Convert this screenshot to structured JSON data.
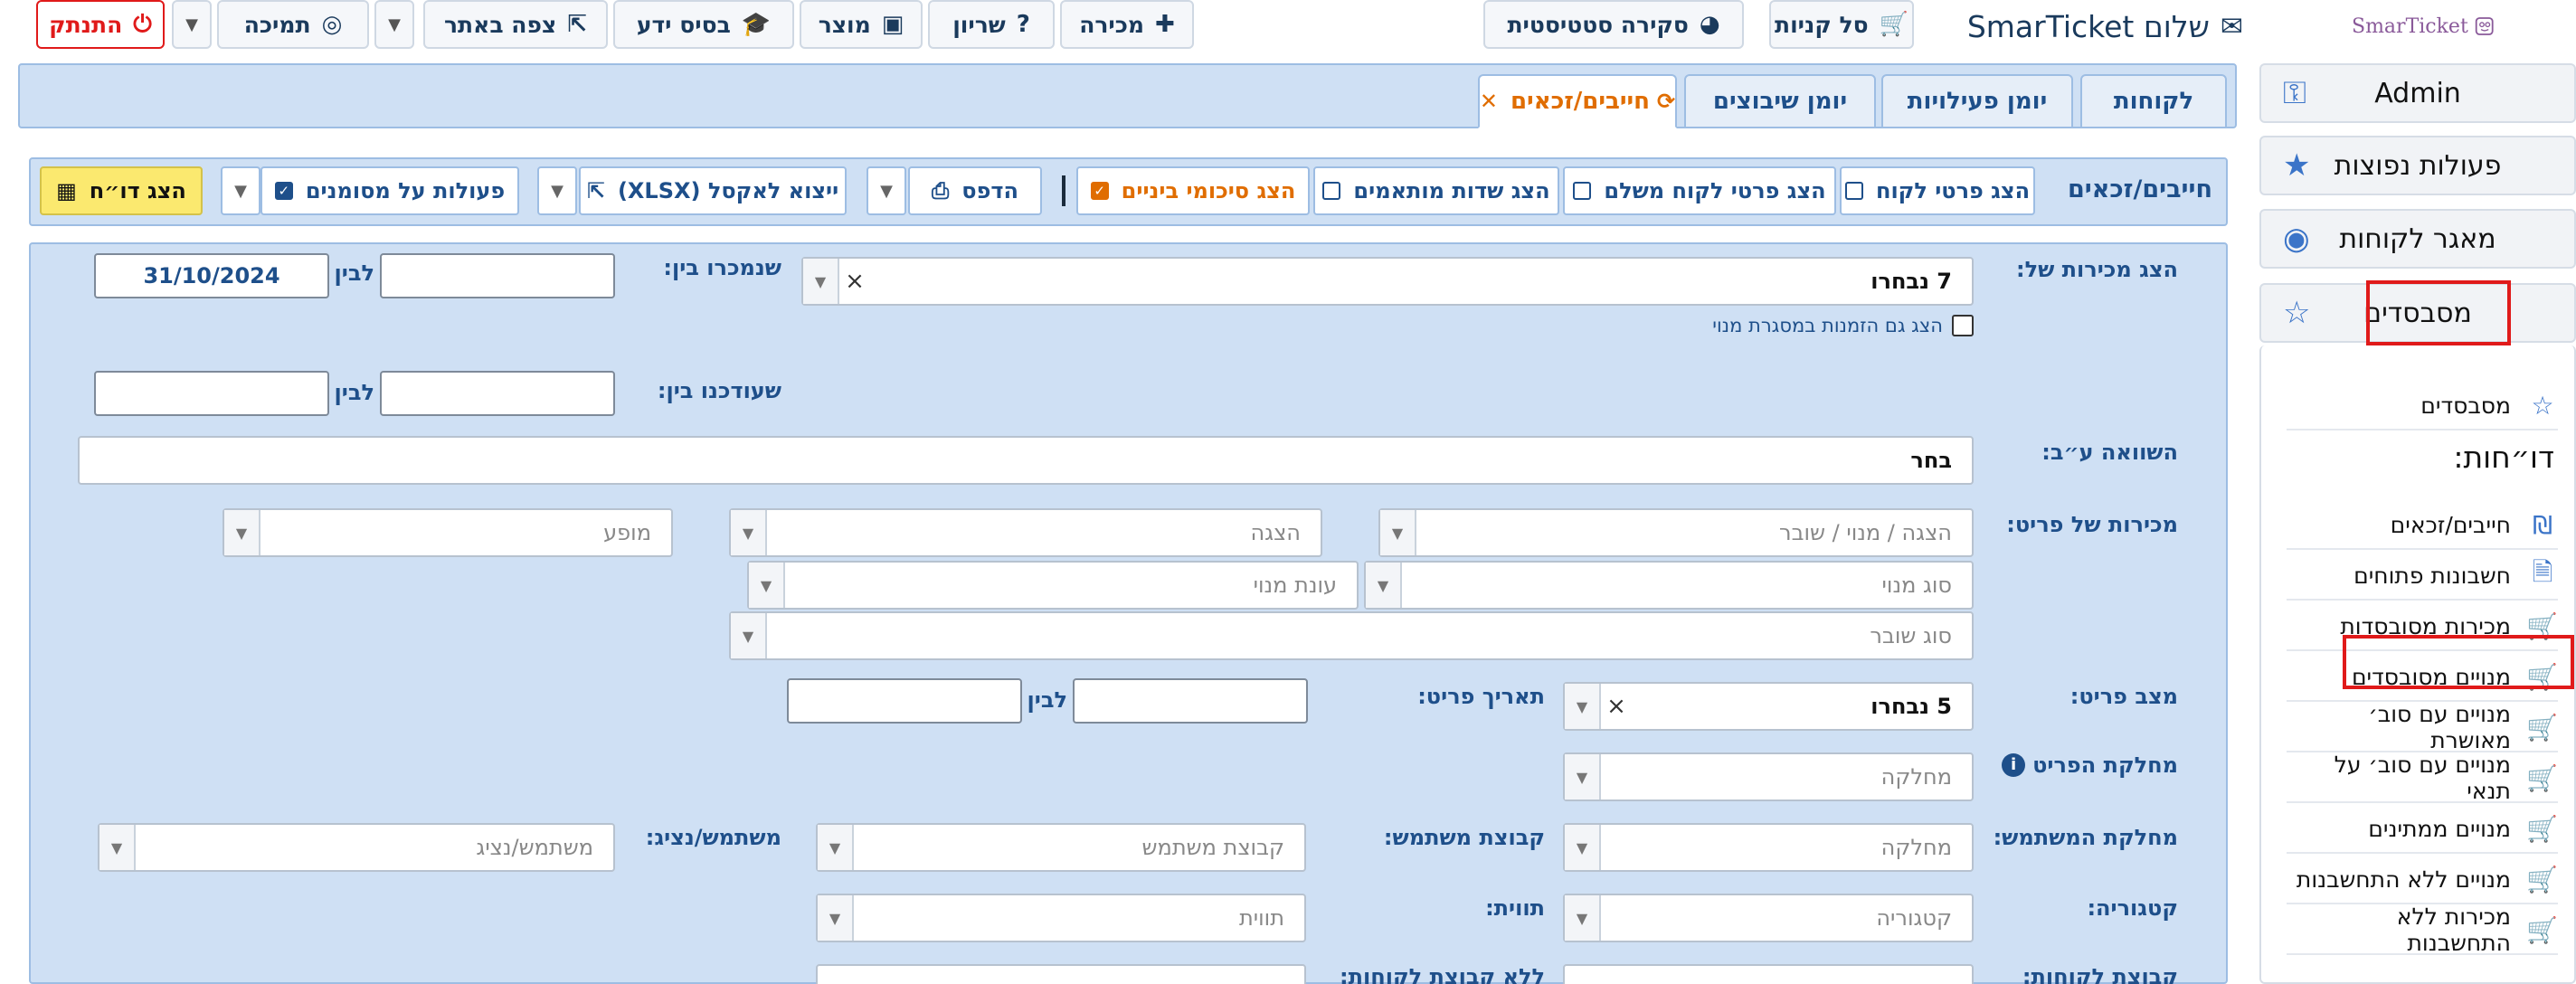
{
  "topbar": {
    "brand_greeting": "שלום SmarTicket",
    "cart": "סל קניות",
    "stats": "סקירה סטטיסטית",
    "sale": "מכירה",
    "help": "שריון",
    "product": "מוצר",
    "knowledge": "בסיס ידע",
    "view_site": "צפה באתר",
    "support": "תמיכה",
    "logout": "התנתק",
    "logo_text": "SmarTicket"
  },
  "sidebar": {
    "admin": "Admin",
    "common_actions": "פעולות נפוצות",
    "customers": "מאגר לקוחות",
    "subsidized": "מסבסדים",
    "subsidized_link": "מסבסדים",
    "reports_heading": "דו״חות:",
    "links": [
      {
        "label": "חייבים/זכאים",
        "icon": "shekel-icon"
      },
      {
        "label": "חשבונות פתוחים",
        "icon": "file-icon"
      },
      {
        "label": "מכירות מסובסדות",
        "icon": "cart-icon"
      },
      {
        "label": "מנויים מסובסדים",
        "icon": "cart-icon"
      },
      {
        "label": "מנויים עם סוב׳ מאושרת",
        "icon": "cart-icon"
      },
      {
        "label": "מנויים עם סוב׳ על תנאי",
        "icon": "cart-icon"
      },
      {
        "label": "מנויים ממתינים",
        "icon": "cart-icon"
      },
      {
        "label": "מנויים ללא התחשבנות",
        "icon": "cart-icon"
      },
      {
        "label": "מכירות ללא התחשבנות",
        "icon": "cart-icon"
      }
    ]
  },
  "tabs": {
    "customers": "לקוחות",
    "activity_log": "יומן פעילויות",
    "placements_log": "יומן שיבוצים",
    "debts": "חייבים/זכאים"
  },
  "toolbar": {
    "title": "חייבים/זכאים",
    "show_customer": "הצג פרטי לקוח",
    "show_payer": "הצג פרטי לקוח משלם",
    "custom_fields": "הצג שדות מותאמים",
    "subtotals": "הצג סיכומי ביניים",
    "print": "הדפס",
    "export": "ייצוא לאקסל (XLSX)",
    "marked_actions": "פעולות על מסומנים",
    "show_report": "הצג דו״ח"
  },
  "form": {
    "show_sales_of": "הצג מכירות של:",
    "sales_selected": "7 נבחרו",
    "include_subscriptions": "הצג גם הזמנות במסגרת מנוי",
    "sold_between": "שנמכרו בין:",
    "to": "לבין",
    "sold_to_value": "31/10/2024",
    "updated_between": "שעודכנו בין:",
    "compared_by": "השוואה ע״ב:",
    "compared_placeholder": "בחר",
    "item_sales": "מכירות של פריט:",
    "ph_show_sub_voucher": "הצגה / מנוי / שובר",
    "ph_show": "הצגה",
    "ph_performance": "מופע",
    "ph_sub_type": "סוג מנוי",
    "ph_sub_season": "עונת מנוי",
    "ph_voucher_type": "סוג שובר",
    "item_status": "מצב פריט:",
    "status_selected": "5 נבחרו",
    "item_date": "תאריך פריט:",
    "item_department": "מחלקת הפריט",
    "ph_department": "מחלקה",
    "user_department": "מחלקת המשתמש:",
    "user_group": "קבוצת משתמש:",
    "ph_user_group": "קבוצת משתמש",
    "user_agent": "משתמש/נציג:",
    "ph_user_agent": "משתמש/נציג",
    "category": "קטגוריה:",
    "ph_category": "קטגוריה",
    "label": "תווית:",
    "ph_label": "תווית",
    "customer_group": "קבוצת לקוחות:",
    "no_customer_group": "ללא קבוצת לקוחות:"
  }
}
